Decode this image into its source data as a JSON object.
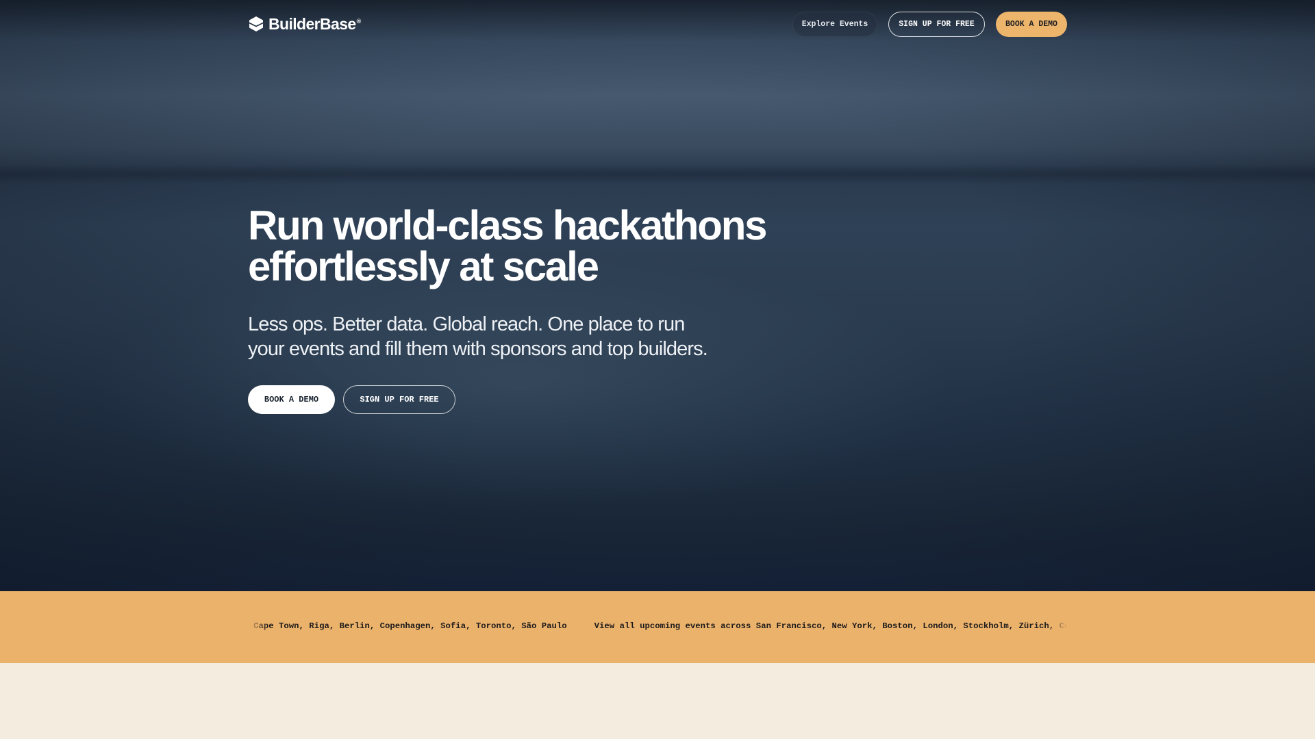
{
  "brand": {
    "name": "BuilderBase",
    "trademark": "®",
    "logo_icon": "hexagon-cube-icon"
  },
  "nav": {
    "explore_label": "Explore Events",
    "signup_label": "SIGN UP FOR FREE",
    "demo_label": "BOOK A DEMO"
  },
  "hero": {
    "headline_line1": "Run world-class hackathons",
    "headline_line2": "effortlessly at scale",
    "subhead_line1": "Less ops. Better data. Global reach. One place to run",
    "subhead_line2": "your events and fill them with sponsors and top builders.",
    "primary_cta": "BOOK A DEMO",
    "secondary_cta": "SIGN UP FOR FREE"
  },
  "ticker": {
    "segment_a": "h, Cape Town, Riga, Berlin, Copenhagen, Sofia, Toronto, São Paulo",
    "segment_b": "View all upcoming events across San Francisco, New York, Boston, London, Stockholm, Zürich, Cape"
  },
  "colors": {
    "accent": "#ebb26c",
    "hero_dark": "#1a2839",
    "page_bg": "#f4ecdf",
    "text_light": "#ffffff"
  }
}
